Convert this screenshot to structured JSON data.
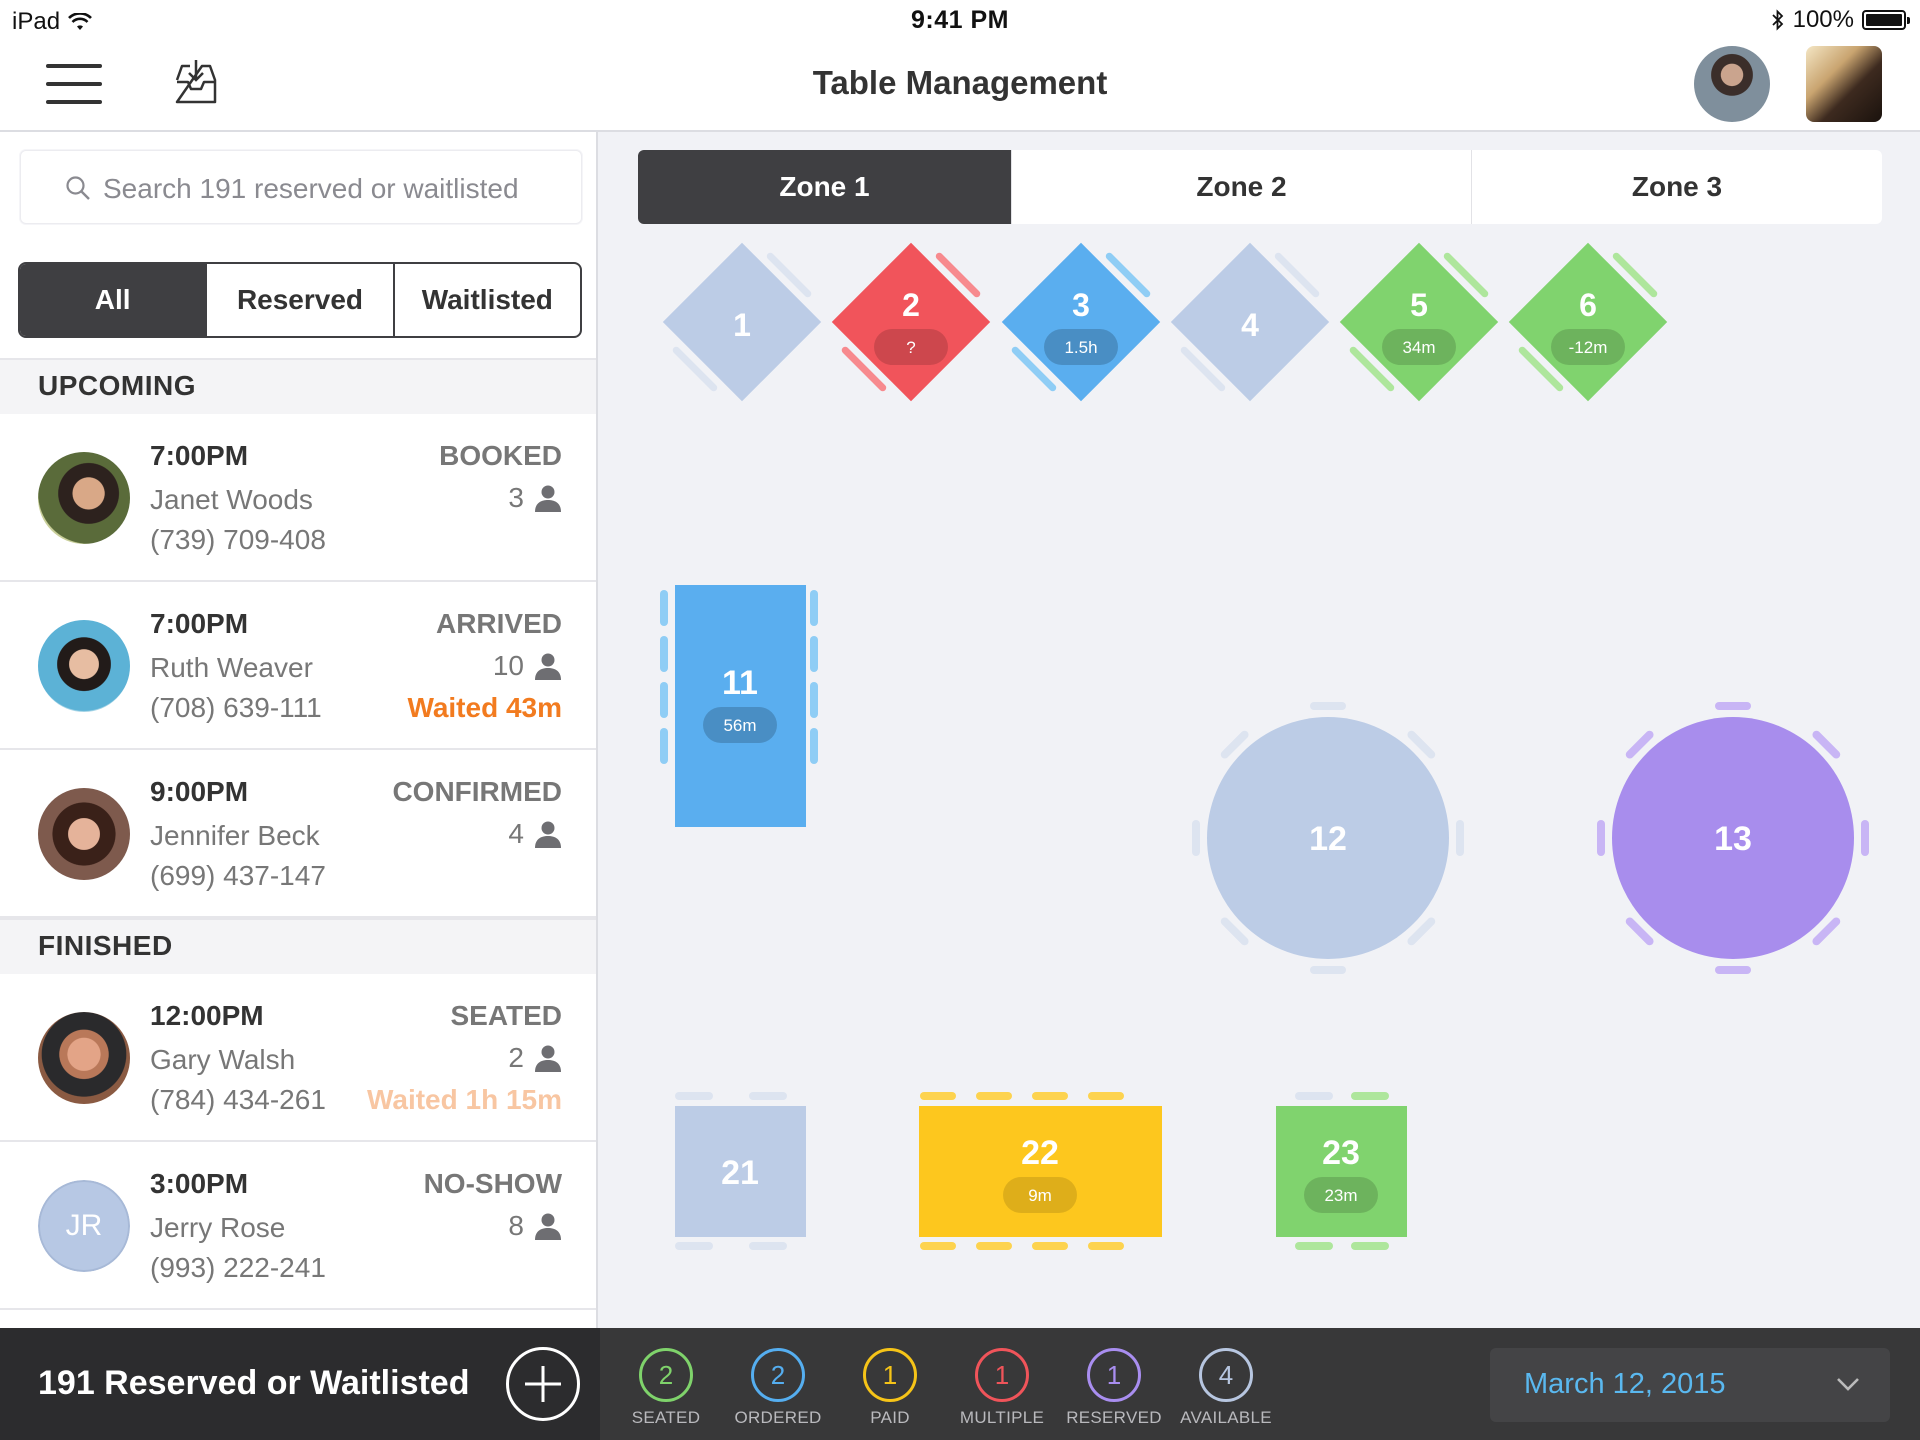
{
  "status_bar": {
    "device": "iPad",
    "time": "9:41 PM",
    "battery": "100%"
  },
  "nav": {
    "title": "Table Management"
  },
  "search": {
    "placeholder": "Search 191 reserved or waitlisted"
  },
  "filters": [
    {
      "label": "All",
      "active": true
    },
    {
      "label": "Reserved",
      "active": false
    },
    {
      "label": "Waitlisted",
      "active": false
    }
  ],
  "sections": {
    "upcoming": "UPCOMING",
    "finished": "FINISHED"
  },
  "reservations_upcoming": [
    {
      "time": "7:00PM",
      "name": "Janet Woods",
      "phone": "(739) 709-408",
      "status": "BOOKED",
      "party": "3",
      "wait": ""
    },
    {
      "time": "7:00PM",
      "name": "Ruth Weaver",
      "phone": "(708) 639-111",
      "status": "ARRIVED",
      "party": "10",
      "wait": "Waited 43m"
    },
    {
      "time": "9:00PM",
      "name": "Jennifer Beck",
      "phone": "(699) 437-147",
      "status": "CONFIRMED",
      "party": "4",
      "wait": ""
    }
  ],
  "reservations_finished": [
    {
      "time": "12:00PM",
      "name": "Gary Walsh",
      "phone": "(784) 434-261",
      "status": "SEATED",
      "party": "2",
      "wait": "Waited 1h 15m"
    },
    {
      "time": "3:00PM",
      "name": "Jerry Rose",
      "phone": "(993) 222-241",
      "status": "NO-SHOW",
      "party": "8",
      "wait": "",
      "initials": "JR"
    }
  ],
  "footer": {
    "summary": "191 Reserved or Waitlisted",
    "date": "March 12, 2015"
  },
  "zones": [
    {
      "label": "Zone 1",
      "active": true
    },
    {
      "label": "Zone 2",
      "active": false
    },
    {
      "label": "Zone 3",
      "active": false
    }
  ],
  "legend": [
    {
      "count": "2",
      "label": "SEATED",
      "color": "#7fd36b"
    },
    {
      "count": "2",
      "label": "ORDERED",
      "color": "#55aef0"
    },
    {
      "count": "1",
      "label": "PAID",
      "color": "#f6c418"
    },
    {
      "count": "1",
      "label": "MULTIPLE",
      "color": "#f0545a"
    },
    {
      "count": "1",
      "label": "RESERVED",
      "color": "#a98ef0"
    },
    {
      "count": "4",
      "label": "AVAILABLE",
      "color": "#b7c6e0"
    }
  ],
  "colors": {
    "available": "#bccce6",
    "multiple": "#f1545b",
    "ordered": "#5aaeef",
    "seated": "#80d36e",
    "paid": "#fdc71e",
    "reserved": "#a88ded"
  },
  "tables": [
    {
      "num": "1",
      "state": "available",
      "time": ""
    },
    {
      "num": "2",
      "state": "multiple",
      "time": "?"
    },
    {
      "num": "3",
      "state": "ordered",
      "time": "1.5h"
    },
    {
      "num": "4",
      "state": "available",
      "time": ""
    },
    {
      "num": "5",
      "state": "seated",
      "time": "34m"
    },
    {
      "num": "6",
      "state": "seated",
      "time": "-12m"
    },
    {
      "num": "11",
      "state": "ordered",
      "time": "56m"
    },
    {
      "num": "12",
      "state": "available",
      "time": ""
    },
    {
      "num": "13",
      "state": "reserved",
      "time": ""
    },
    {
      "num": "21",
      "state": "available",
      "time": ""
    },
    {
      "num": "22",
      "state": "paid",
      "time": "9m"
    },
    {
      "num": "23",
      "state": "seated",
      "time": "23m"
    }
  ]
}
